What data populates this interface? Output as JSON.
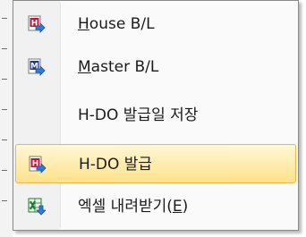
{
  "menu": {
    "items": [
      {
        "icon": "house-bl-doc-icon",
        "label_first": "H",
        "label_rest": "ouse B/L"
      },
      {
        "icon": "master-bl-doc-icon",
        "label_first": "M",
        "label_rest": "aster B/L"
      },
      {
        "label": "H-DO 발급일 저장"
      },
      {
        "icon": "h-do-issue-doc-icon",
        "label": "H-DO 발급",
        "highlighted": true
      },
      {
        "icon": "excel-download-icon",
        "label_main": "엑셀 내려받기(",
        "label_key": "E",
        "label_close": ")"
      }
    ]
  },
  "colors": {
    "highlight_top": "#fff7d6",
    "highlight_bottom": "#ffe28a",
    "highlight_border": "#e8b84e",
    "doc_red": "#c0143c",
    "doc_blue": "#1f3a8a",
    "arrow_blue": "#2a7de1",
    "excel_green": "#1e7d32"
  }
}
